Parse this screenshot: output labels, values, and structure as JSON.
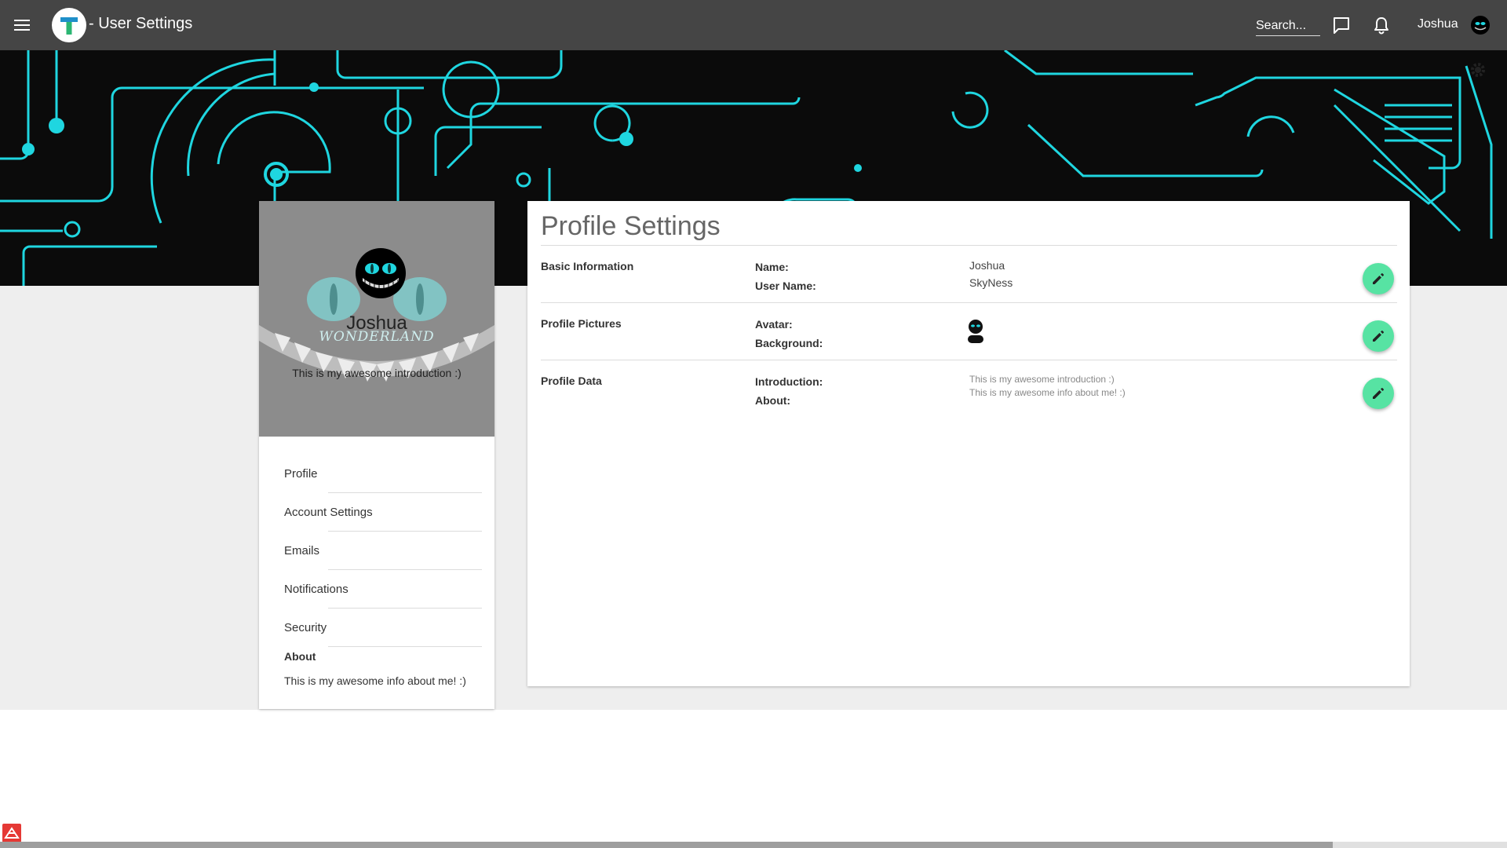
{
  "topbar": {
    "app_title": "- User Settings",
    "search_placeholder": "Search...",
    "user_name": "Joshua"
  },
  "profile": {
    "name": "Joshua",
    "introduction": "This is my awesome introduction :)",
    "background_logo_text": "WONDERLAND"
  },
  "sidebar": {
    "items": [
      {
        "label": "Profile"
      },
      {
        "label": "Account Settings"
      },
      {
        "label": "Emails"
      },
      {
        "label": "Notifications"
      },
      {
        "label": "Security"
      }
    ],
    "about_title": "About",
    "about_text": "This is my awesome info about me! :)"
  },
  "settings": {
    "title": "Profile Settings",
    "sections": [
      {
        "title": "Basic Information",
        "labels": [
          "Name:",
          "User Name:"
        ],
        "values": [
          "Joshua",
          "SkyNess"
        ]
      },
      {
        "title": "Profile Pictures",
        "labels": [
          "Avatar:",
          "Background:"
        ],
        "values": []
      },
      {
        "title": "Profile Data",
        "labels": [
          "Introduction:",
          "About:"
        ],
        "values": [
          "This is my awesome introduction :)",
          "This is my awesome info about me! :)"
        ]
      }
    ]
  },
  "colors": {
    "topbar": "#454545",
    "banner_bg": "#0b0b0b",
    "circuit": "#1fd6e0",
    "edit_button": "#57e3a3",
    "page_grey": "#eeeeee"
  },
  "icons": {
    "menu": "hamburger-icon",
    "chat": "chat-bubble-icon",
    "notifications": "bell-icon",
    "edit": "pencil-icon",
    "banner_settings": "gear-icon"
  },
  "scrollbar": {
    "position_fraction": 0.88
  }
}
